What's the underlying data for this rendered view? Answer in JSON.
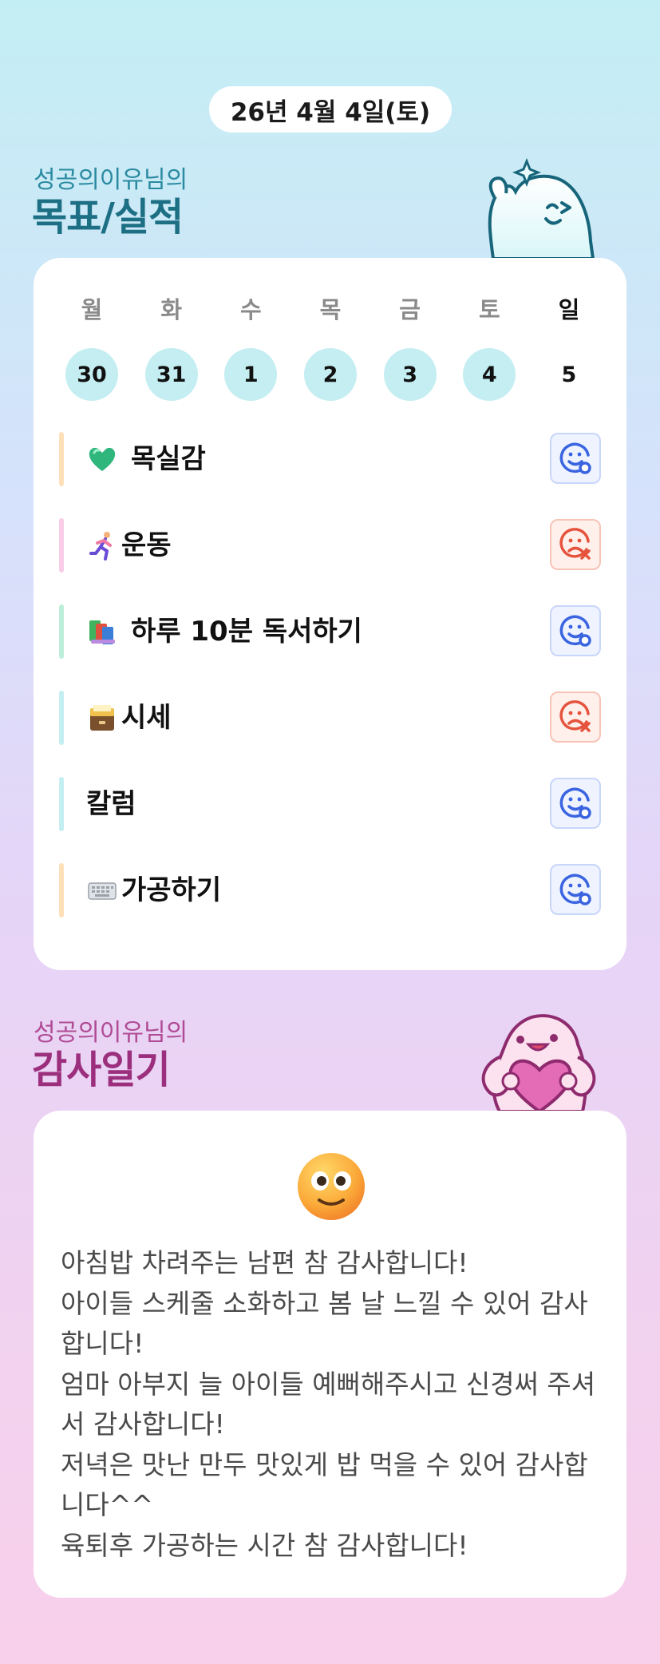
{
  "header": {
    "date": "26년 4월 4일(토)"
  },
  "goals": {
    "subtitle": "성공의이유님의",
    "title": "목표/실적",
    "week": {
      "days": [
        {
          "label": "월",
          "num": "30",
          "marked": true
        },
        {
          "label": "화",
          "num": "31",
          "marked": true
        },
        {
          "label": "수",
          "num": "1",
          "marked": true
        },
        {
          "label": "목",
          "num": "2",
          "marked": true
        },
        {
          "label": "금",
          "num": "3",
          "marked": true
        },
        {
          "label": "토",
          "num": "4",
          "marked": true
        },
        {
          "label": "일",
          "num": "5",
          "marked": false
        }
      ]
    },
    "items": [
      {
        "name": "목실감",
        "icon": "green-heart-icon",
        "bar_color": "#fde0b8",
        "status": "done"
      },
      {
        "name": "운동",
        "icon": "runner-icon",
        "bar_color": "#f9cde8",
        "status": "missed"
      },
      {
        "name": "하루 10분 독서하기",
        "icon": "books-icon",
        "bar_color": "#bdeed9",
        "status": "done"
      },
      {
        "name": "시세",
        "icon": "file-cabinet-icon",
        "bar_color": "#c4eef2",
        "status": "missed"
      },
      {
        "name": "칼럼",
        "icon": "",
        "bar_color": "#c4eef2",
        "status": "done"
      },
      {
        "name": "가공하기",
        "icon": "keyboard-icon",
        "bar_color": "#fde0b8",
        "status": "done"
      }
    ]
  },
  "gratitude": {
    "subtitle": "성공의이유님의",
    "title": "감사일기",
    "mood_icon": "smiling-face-icon",
    "text": "아침밥 차려주는 남편 참 감사합니다!\n아이들 스케줄 소화하고 봄 날 느낄 수 있어 감사합니다!\n엄마 아부지 늘 아이들 예뻐해주시고 신경써 주셔서 감사합니다!\n저녁은 맛난 만두 맛있게 밥 먹을 수 있어 감사합니다^^\n육퇴후 가공하는 시간 참 감사합니다!"
  },
  "colors": {
    "done": "#3a64e0",
    "missed": "#e5533c"
  }
}
